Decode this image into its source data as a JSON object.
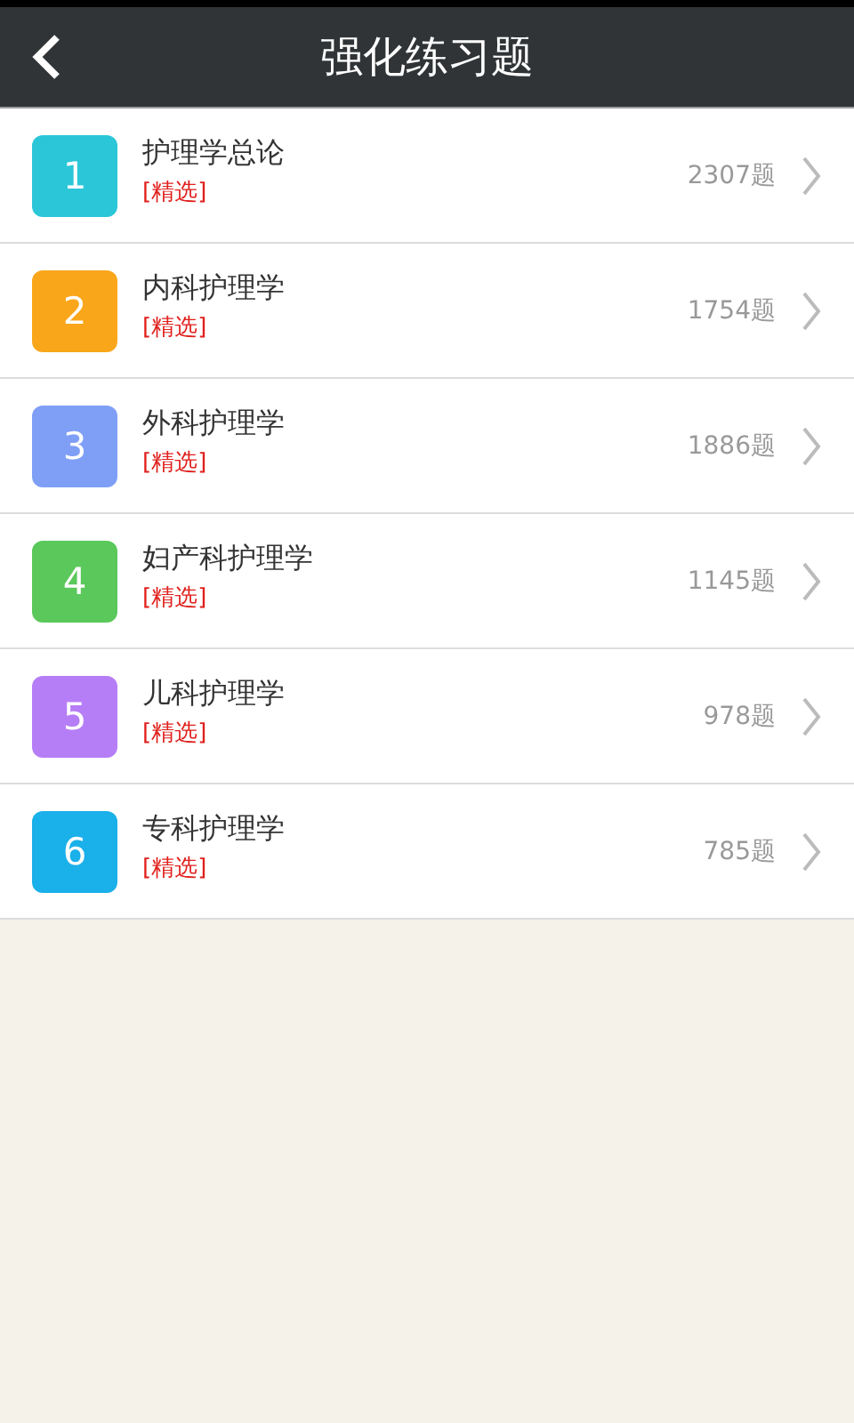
{
  "header": {
    "title": "强化练习题"
  },
  "items": [
    {
      "number": "1",
      "color": "#2bc6d8",
      "name": "护理学总论",
      "tag": "[精选]",
      "count": "2307题"
    },
    {
      "number": "2",
      "color": "#f9a61a",
      "name": "内科护理学",
      "tag": "[精选]",
      "count": "1754题"
    },
    {
      "number": "3",
      "color": "#7f9ff7",
      "name": "外科护理学",
      "tag": "[精选]",
      "count": "1886题"
    },
    {
      "number": "4",
      "color": "#5ac85a",
      "name": "妇产科护理学",
      "tag": "[精选]",
      "count": "1145题"
    },
    {
      "number": "5",
      "color": "#b67ef6",
      "name": "儿科护理学",
      "tag": "[精选]",
      "count": "978题"
    },
    {
      "number": "6",
      "color": "#1ab0ea",
      "name": "专科护理学",
      "tag": "[精选]",
      "count": "785题"
    }
  ]
}
